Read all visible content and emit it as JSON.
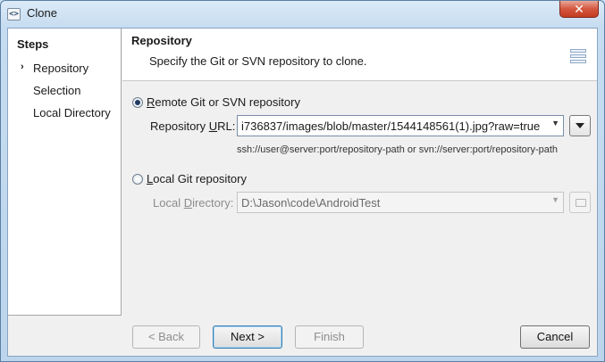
{
  "window": {
    "title": "Clone",
    "app_icon": "<>",
    "close_glyph": "✕"
  },
  "steps": {
    "title": "Steps",
    "current_marker": "›",
    "items": [
      {
        "label": "Repository",
        "current": true
      },
      {
        "label": "Selection",
        "current": false
      },
      {
        "label": "Local Directory",
        "current": false
      }
    ]
  },
  "header": {
    "title": "Repository",
    "description": "Specify the Git or SVN repository to clone.",
    "icon": "repository-stack-icon"
  },
  "remote": {
    "option_pre": "",
    "option_accel": "R",
    "option_post": "emote Git or SVN repository",
    "selected": true,
    "url_label_pre": "Repository ",
    "url_label_accel": "U",
    "url_label_post": "RL:",
    "url_value": "i736837/images/blob/master/1544148561(1).jpg?raw=true",
    "hint": "ssh://user@server:port/repository-path or svn://server:port/repository-path"
  },
  "local": {
    "option_pre": "",
    "option_accel": "L",
    "option_post": "ocal Git repository",
    "selected": false,
    "dir_label_pre": "Local ",
    "dir_label_accel": "D",
    "dir_label_post": "irectory:",
    "dir_value": "D:\\Jason\\code\\AndroidTest"
  },
  "buttons": {
    "back": "< Back",
    "next": "Next >",
    "finish": "Finish",
    "cancel": "Cancel"
  }
}
